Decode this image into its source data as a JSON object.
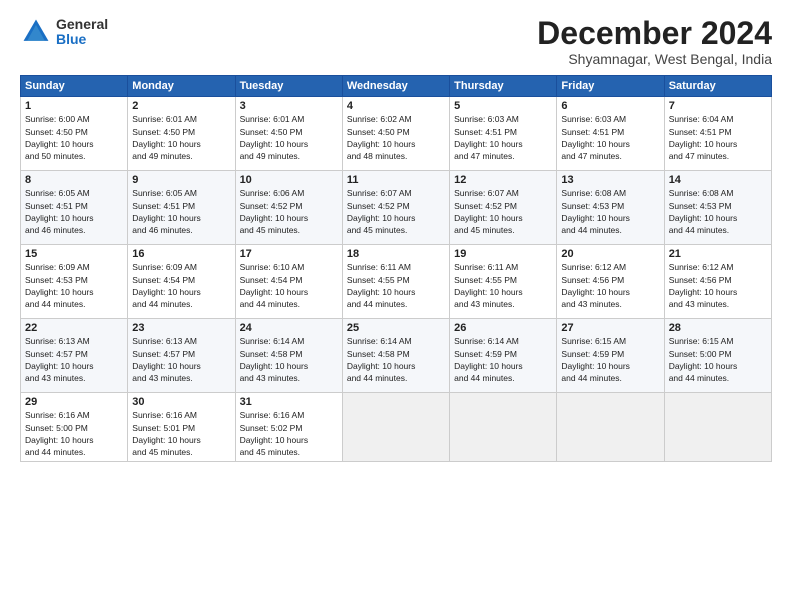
{
  "logo": {
    "general": "General",
    "blue": "Blue"
  },
  "header": {
    "month": "December 2024",
    "location": "Shyamnagar, West Bengal, India"
  },
  "weekdays": [
    "Sunday",
    "Monday",
    "Tuesday",
    "Wednesday",
    "Thursday",
    "Friday",
    "Saturday"
  ],
  "weeks": [
    [
      {
        "day": "1",
        "info": "Sunrise: 6:00 AM\nSunset: 4:50 PM\nDaylight: 10 hours\nand 50 minutes."
      },
      {
        "day": "2",
        "info": "Sunrise: 6:01 AM\nSunset: 4:50 PM\nDaylight: 10 hours\nand 49 minutes."
      },
      {
        "day": "3",
        "info": "Sunrise: 6:01 AM\nSunset: 4:50 PM\nDaylight: 10 hours\nand 49 minutes."
      },
      {
        "day": "4",
        "info": "Sunrise: 6:02 AM\nSunset: 4:50 PM\nDaylight: 10 hours\nand 48 minutes."
      },
      {
        "day": "5",
        "info": "Sunrise: 6:03 AM\nSunset: 4:51 PM\nDaylight: 10 hours\nand 47 minutes."
      },
      {
        "day": "6",
        "info": "Sunrise: 6:03 AM\nSunset: 4:51 PM\nDaylight: 10 hours\nand 47 minutes."
      },
      {
        "day": "7",
        "info": "Sunrise: 6:04 AM\nSunset: 4:51 PM\nDaylight: 10 hours\nand 47 minutes."
      }
    ],
    [
      {
        "day": "8",
        "info": "Sunrise: 6:05 AM\nSunset: 4:51 PM\nDaylight: 10 hours\nand 46 minutes."
      },
      {
        "day": "9",
        "info": "Sunrise: 6:05 AM\nSunset: 4:51 PM\nDaylight: 10 hours\nand 46 minutes."
      },
      {
        "day": "10",
        "info": "Sunrise: 6:06 AM\nSunset: 4:52 PM\nDaylight: 10 hours\nand 45 minutes."
      },
      {
        "day": "11",
        "info": "Sunrise: 6:07 AM\nSunset: 4:52 PM\nDaylight: 10 hours\nand 45 minutes."
      },
      {
        "day": "12",
        "info": "Sunrise: 6:07 AM\nSunset: 4:52 PM\nDaylight: 10 hours\nand 45 minutes."
      },
      {
        "day": "13",
        "info": "Sunrise: 6:08 AM\nSunset: 4:53 PM\nDaylight: 10 hours\nand 44 minutes."
      },
      {
        "day": "14",
        "info": "Sunrise: 6:08 AM\nSunset: 4:53 PM\nDaylight: 10 hours\nand 44 minutes."
      }
    ],
    [
      {
        "day": "15",
        "info": "Sunrise: 6:09 AM\nSunset: 4:53 PM\nDaylight: 10 hours\nand 44 minutes."
      },
      {
        "day": "16",
        "info": "Sunrise: 6:09 AM\nSunset: 4:54 PM\nDaylight: 10 hours\nand 44 minutes."
      },
      {
        "day": "17",
        "info": "Sunrise: 6:10 AM\nSunset: 4:54 PM\nDaylight: 10 hours\nand 44 minutes."
      },
      {
        "day": "18",
        "info": "Sunrise: 6:11 AM\nSunset: 4:55 PM\nDaylight: 10 hours\nand 44 minutes."
      },
      {
        "day": "19",
        "info": "Sunrise: 6:11 AM\nSunset: 4:55 PM\nDaylight: 10 hours\nand 43 minutes."
      },
      {
        "day": "20",
        "info": "Sunrise: 6:12 AM\nSunset: 4:56 PM\nDaylight: 10 hours\nand 43 minutes."
      },
      {
        "day": "21",
        "info": "Sunrise: 6:12 AM\nSunset: 4:56 PM\nDaylight: 10 hours\nand 43 minutes."
      }
    ],
    [
      {
        "day": "22",
        "info": "Sunrise: 6:13 AM\nSunset: 4:57 PM\nDaylight: 10 hours\nand 43 minutes."
      },
      {
        "day": "23",
        "info": "Sunrise: 6:13 AM\nSunset: 4:57 PM\nDaylight: 10 hours\nand 43 minutes."
      },
      {
        "day": "24",
        "info": "Sunrise: 6:14 AM\nSunset: 4:58 PM\nDaylight: 10 hours\nand 43 minutes."
      },
      {
        "day": "25",
        "info": "Sunrise: 6:14 AM\nSunset: 4:58 PM\nDaylight: 10 hours\nand 44 minutes."
      },
      {
        "day": "26",
        "info": "Sunrise: 6:14 AM\nSunset: 4:59 PM\nDaylight: 10 hours\nand 44 minutes."
      },
      {
        "day": "27",
        "info": "Sunrise: 6:15 AM\nSunset: 4:59 PM\nDaylight: 10 hours\nand 44 minutes."
      },
      {
        "day": "28",
        "info": "Sunrise: 6:15 AM\nSunset: 5:00 PM\nDaylight: 10 hours\nand 44 minutes."
      }
    ],
    [
      {
        "day": "29",
        "info": "Sunrise: 6:16 AM\nSunset: 5:00 PM\nDaylight: 10 hours\nand 44 minutes."
      },
      {
        "day": "30",
        "info": "Sunrise: 6:16 AM\nSunset: 5:01 PM\nDaylight: 10 hours\nand 45 minutes."
      },
      {
        "day": "31",
        "info": "Sunrise: 6:16 AM\nSunset: 5:02 PM\nDaylight: 10 hours\nand 45 minutes."
      },
      {
        "day": "",
        "info": ""
      },
      {
        "day": "",
        "info": ""
      },
      {
        "day": "",
        "info": ""
      },
      {
        "day": "",
        "info": ""
      }
    ]
  ]
}
